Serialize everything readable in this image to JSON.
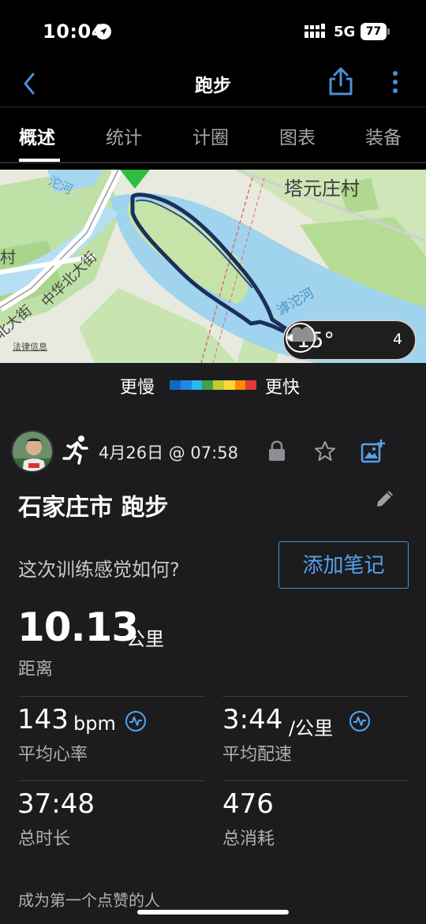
{
  "status_bar": {
    "time": "10:04",
    "network": "5G",
    "battery": "77"
  },
  "nav": {
    "title": "跑步"
  },
  "tabs": [
    {
      "label": "概述",
      "active": true
    },
    {
      "label": "统计",
      "active": false
    },
    {
      "label": "计圈",
      "active": false
    },
    {
      "label": "图表",
      "active": false
    },
    {
      "label": "装备",
      "active": false
    }
  ],
  "map": {
    "place_label": "塔元庄村",
    "road_label_1": "中华北大街",
    "road_label_2": "北大街",
    "river_label": "滹沱河",
    "legal_label": "法律信息",
    "weather_temp": "15°",
    "wind_speed": "4"
  },
  "pace_legend": {
    "slow_label": "更慢",
    "fast_label": "更快",
    "colors": [
      "#1565c0",
      "#1e88e5",
      "#29b6f6",
      "#43a047",
      "#c0ca33",
      "#fdd835",
      "#fb8c00",
      "#e53935"
    ]
  },
  "activity": {
    "date": "4月26日 @ 07:58",
    "title": "石家庄市 跑步",
    "feel_prompt": "这次训练感觉如何?",
    "add_note_label": "添加笔记",
    "distance": {
      "value": "10.13",
      "unit": "公里",
      "label": "距离"
    },
    "stats": [
      {
        "value": "143",
        "unit": "bpm",
        "label": "平均心率"
      },
      {
        "value": "3:44",
        "unit": "/公里",
        "label": "平均配速"
      },
      {
        "value": "37:48",
        "unit": "",
        "label": "总时长"
      },
      {
        "value": "476",
        "unit": "",
        "label": "总消耗"
      }
    ],
    "likes_prompt": "成为第一个点赞的人"
  },
  "colors": {
    "accent": "#4a90d9",
    "background": "#1c1c1e",
    "route": "#1a2f5c"
  }
}
